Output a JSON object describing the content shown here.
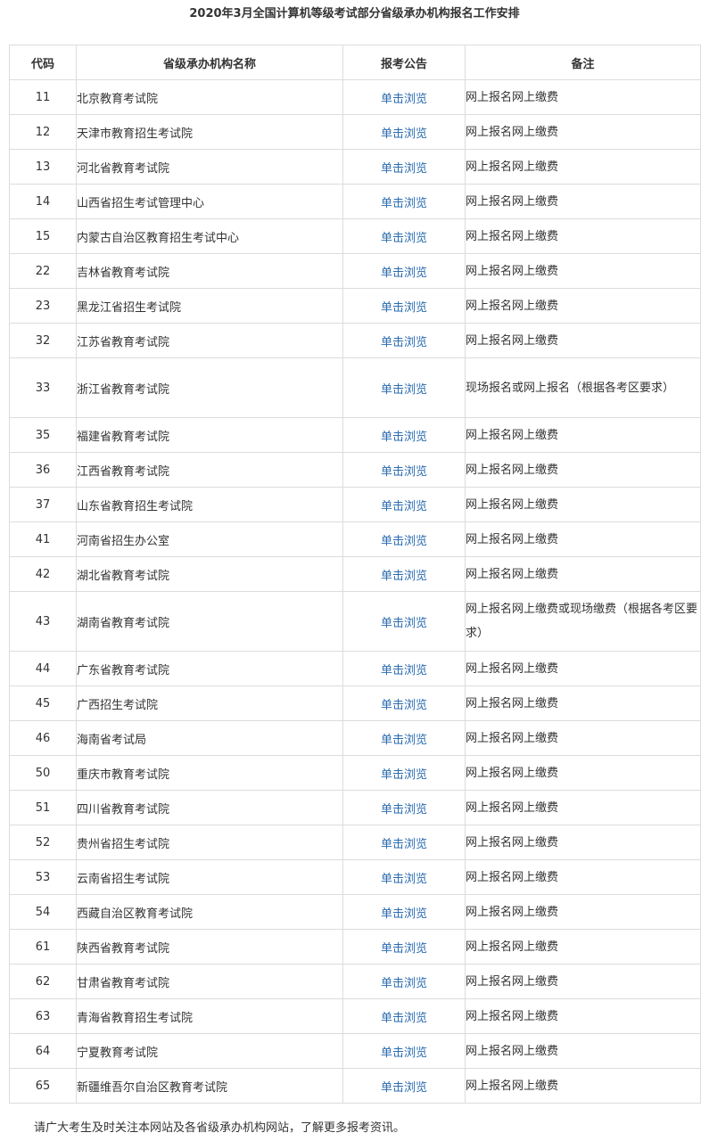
{
  "title": "2020年3月全国计算机等级考试部分省级承办机构报名工作安排",
  "table": {
    "headers": [
      "代码",
      "省级承办机构名称",
      "报考公告",
      "备注"
    ],
    "rows": [
      {
        "code": "11",
        "name": "北京教育考试院",
        "link": "单击浏览",
        "note": "网上报名网上缴费"
      },
      {
        "code": "12",
        "name": "天津市教育招生考试院",
        "link": "单击浏览",
        "note": "网上报名网上缴费"
      },
      {
        "code": "13",
        "name": "河北省教育考试院",
        "link": "单击浏览",
        "note": "网上报名网上缴费"
      },
      {
        "code": "14",
        "name": "山西省招生考试管理中心",
        "link": "单击浏览",
        "note": "网上报名网上缴费"
      },
      {
        "code": "15",
        "name": "内蒙古自治区教育招生考试中心",
        "link": "单击浏览",
        "note": "网上报名网上缴费"
      },
      {
        "code": "22",
        "name": "吉林省教育考试院",
        "link": "单击浏览",
        "note": "网上报名网上缴费"
      },
      {
        "code": "23",
        "name": "黑龙江省招生考试院",
        "link": "单击浏览",
        "note": "网上报名网上缴费"
      },
      {
        "code": "32",
        "name": "江苏省教育考试院",
        "link": "单击浏览",
        "note": "网上报名网上缴费"
      },
      {
        "code": "33",
        "name": "浙江省教育考试院",
        "link": "单击浏览",
        "note": "现场报名或网上报名（根据各考区要求）"
      },
      {
        "code": "35",
        "name": "福建省教育考试院",
        "link": "单击浏览",
        "note": "网上报名网上缴费"
      },
      {
        "code": "36",
        "name": "江西省教育考试院",
        "link": "单击浏览",
        "note": "网上报名网上缴费"
      },
      {
        "code": "37",
        "name": "山东省教育招生考试院",
        "link": "单击浏览",
        "note": "网上报名网上缴费"
      },
      {
        "code": "41",
        "name": "河南省招生办公室",
        "link": "单击浏览",
        "note": "网上报名网上缴费"
      },
      {
        "code": "42",
        "name": "湖北省教育考试院",
        "link": "单击浏览",
        "note": "网上报名网上缴费"
      },
      {
        "code": "43",
        "name": "湖南省教育考试院",
        "link": "单击浏览",
        "note": "网上报名网上缴费或现场缴费（根据各考区要求）"
      },
      {
        "code": "44",
        "name": "广东省教育考试院",
        "link": "单击浏览",
        "note": "网上报名网上缴费"
      },
      {
        "code": "45",
        "name": "广西招生考试院",
        "link": "单击浏览",
        "note": "网上报名网上缴费"
      },
      {
        "code": "46",
        "name": "海南省考试局",
        "link": "单击浏览",
        "note": "网上报名网上缴费"
      },
      {
        "code": "50",
        "name": "重庆市教育考试院",
        "link": "单击浏览",
        "note": "网上报名网上缴费"
      },
      {
        "code": "51",
        "name": "四川省教育考试院",
        "link": "单击浏览",
        "note": "网上报名网上缴费"
      },
      {
        "code": "52",
        "name": "贵州省招生考试院",
        "link": "单击浏览",
        "note": "网上报名网上缴费"
      },
      {
        "code": "53",
        "name": "云南省招生考试院",
        "link": "单击浏览",
        "note": "网上报名网上缴费"
      },
      {
        "code": "54",
        "name": "西藏自治区教育考试院",
        "link": "单击浏览",
        "note": "网上报名网上缴费"
      },
      {
        "code": "61",
        "name": "陕西省教育考试院",
        "link": "单击浏览",
        "note": "网上报名网上缴费"
      },
      {
        "code": "62",
        "name": "甘肃省教育考试院",
        "link": "单击浏览",
        "note": "网上报名网上缴费"
      },
      {
        "code": "63",
        "name": "青海省教育招生考试院",
        "link": "单击浏览",
        "note": "网上报名网上缴费"
      },
      {
        "code": "64",
        "name": "宁夏教育考试院",
        "link": "单击浏览",
        "note": "网上报名网上缴费"
      },
      {
        "code": "65",
        "name": "新疆维吾尔自治区教育考试院",
        "link": "单击浏览",
        "note": "网上报名网上缴费"
      }
    ]
  },
  "footer": "请广大考生及时关注本网站及各省级承办机构网站，了解更多报考资讯。",
  "colors": {
    "link": "#2b6cb0",
    "text": "#333333",
    "border": "#dcdcdc"
  }
}
